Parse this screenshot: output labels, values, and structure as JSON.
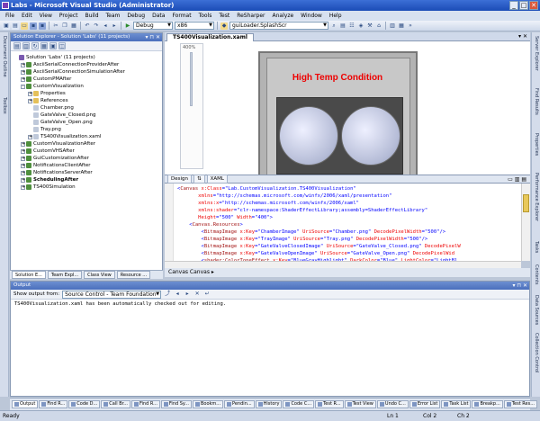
{
  "window": {
    "title": "Labs - Microsoft Visual Studio (Administrator)"
  },
  "menu": [
    "File",
    "Edit",
    "View",
    "Project",
    "Build",
    "Team",
    "Debug",
    "Data",
    "Format",
    "Tools",
    "Test",
    "ReSharper",
    "Analyze",
    "Window",
    "Help"
  ],
  "toolbar": {
    "config": "Debug",
    "platform": "x86",
    "startup": "guiLoader.SplashScr"
  },
  "left_strip": [
    "Document Outline",
    "Toolbox"
  ],
  "right_strip": [
    "Server Explorer",
    "Find Results",
    "Properties",
    "Performance Explorer",
    "Tasks",
    "Contents",
    "Data Sources",
    "Collection Control"
  ],
  "solution_explorer": {
    "title": "Solution Explorer - Solution 'Labs' (11 projects)",
    "tree": [
      {
        "label": "Solution 'Labs' (11 projects)",
        "indent": 0,
        "icon": "sol",
        "bold": false,
        "exp": ""
      },
      {
        "label": "AsciiSerialConnectionProviderAfter",
        "indent": 1,
        "icon": "proj",
        "bold": false,
        "exp": "+"
      },
      {
        "label": "AsciiSerialConnectionSimulationAfter",
        "indent": 1,
        "icon": "proj",
        "bold": false,
        "exp": "+"
      },
      {
        "label": "CustomPMAfter",
        "indent": 1,
        "icon": "proj",
        "bold": false,
        "exp": "+"
      },
      {
        "label": "CustomVisualization",
        "indent": 1,
        "icon": "proj",
        "bold": false,
        "exp": "-"
      },
      {
        "label": "Properties",
        "indent": 2,
        "icon": "folder",
        "bold": false,
        "exp": "+"
      },
      {
        "label": "References",
        "indent": 2,
        "icon": "folder",
        "bold": false,
        "exp": "+"
      },
      {
        "label": "Chamber.png",
        "indent": 2,
        "icon": "file",
        "bold": false,
        "exp": ""
      },
      {
        "label": "GateValve_Closed.png",
        "indent": 2,
        "icon": "file",
        "bold": false,
        "exp": ""
      },
      {
        "label": "GateValve_Open.png",
        "indent": 2,
        "icon": "file",
        "bold": false,
        "exp": ""
      },
      {
        "label": "Tray.png",
        "indent": 2,
        "icon": "file",
        "bold": false,
        "exp": ""
      },
      {
        "label": "TS400Visualization.xaml",
        "indent": 2,
        "icon": "file",
        "bold": false,
        "exp": "+"
      },
      {
        "label": "CustomVisualizationAfter",
        "indent": 1,
        "icon": "proj",
        "bold": false,
        "exp": "+"
      },
      {
        "label": "CustomVHSAfter",
        "indent": 1,
        "icon": "proj",
        "bold": false,
        "exp": "+"
      },
      {
        "label": "GuiCustomizationAfter",
        "indent": 1,
        "icon": "proj",
        "bold": false,
        "exp": "+"
      },
      {
        "label": "NotificationsClientAfter",
        "indent": 1,
        "icon": "proj",
        "bold": false,
        "exp": "+"
      },
      {
        "label": "NotificationsServerAfter",
        "indent": 1,
        "icon": "proj",
        "bold": false,
        "exp": "+"
      },
      {
        "label": "SchedulingAfter",
        "indent": 1,
        "icon": "proj",
        "bold": true,
        "exp": "+"
      },
      {
        "label": "TS400Simulation",
        "indent": 1,
        "icon": "proj",
        "bold": false,
        "exp": "+"
      }
    ],
    "tabs": [
      "Solution E...",
      "Team Expl...",
      "Class View",
      "Resource ..."
    ]
  },
  "document": {
    "tab": "TS400Visualization.xaml",
    "zoom": "400%",
    "canvas_title": "High Temp Condition",
    "split_tabs": [
      "Design",
      "⇅",
      "XAML"
    ],
    "breadcrumb": "Canvas  Canvas ▸",
    "code": [
      [
        [
          "t-pun",
          "<"
        ],
        [
          "t-tag",
          "Canvas"
        ],
        [
          "t-attr",
          " x:Class"
        ],
        [
          "t-pun",
          "="
        ],
        [
          "t-val",
          "\"Lab.CustomVisualization.TS400Visualization\""
        ]
      ],
      [
        [
          "t-attr",
          "       xmlns"
        ],
        [
          "t-pun",
          "="
        ],
        [
          "t-val",
          "\"http://schemas.microsoft.com/winfx/2006/xaml/presentation\""
        ]
      ],
      [
        [
          "t-attr",
          "       xmlns:x"
        ],
        [
          "t-pun",
          "="
        ],
        [
          "t-val",
          "\"http://schemas.microsoft.com/winfx/2006/xaml\""
        ]
      ],
      [
        [
          "t-attr",
          "       xmlns:shader"
        ],
        [
          "t-pun",
          "="
        ],
        [
          "t-val",
          "\"clr-namespace:ShaderEffectLibrary;assembly=ShaderEffectLibrary\""
        ]
      ],
      [
        [
          "t-attr",
          "       Height"
        ],
        [
          "t-pun",
          "="
        ],
        [
          "t-val",
          "\"500\""
        ],
        [
          "t-attr",
          " Width"
        ],
        [
          "t-pun",
          "="
        ],
        [
          "t-val",
          "\"400\""
        ],
        [
          "t-pun",
          ">"
        ]
      ],
      [
        [
          "t-pun",
          "    <"
        ],
        [
          "t-tag",
          "Canvas.Resources"
        ],
        [
          "t-pun",
          ">"
        ]
      ],
      [
        [
          "t-pun",
          "        <"
        ],
        [
          "t-tag",
          "BitmapImage"
        ],
        [
          "t-attr",
          " x:Key"
        ],
        [
          "t-pun",
          "="
        ],
        [
          "t-val",
          "\"ChamberImage\""
        ],
        [
          "t-attr",
          " UriSource"
        ],
        [
          "t-pun",
          "="
        ],
        [
          "t-val",
          "\"Chamber.png\""
        ],
        [
          "t-attr",
          " DecodePixelWidth"
        ],
        [
          "t-pun",
          "="
        ],
        [
          "t-val",
          "\"500\""
        ],
        [
          "t-pun",
          "/>"
        ]
      ],
      [
        [
          "t-pun",
          "        <"
        ],
        [
          "t-tag",
          "BitmapImage"
        ],
        [
          "t-attr",
          " x:Key"
        ],
        [
          "t-pun",
          "="
        ],
        [
          "t-val",
          "\"TrayImage\""
        ],
        [
          "t-attr",
          " UriSource"
        ],
        [
          "t-pun",
          "="
        ],
        [
          "t-val",
          "\"Tray.png\""
        ],
        [
          "t-attr",
          " DecodePixelWidth"
        ],
        [
          "t-pun",
          "="
        ],
        [
          "t-val",
          "\"500\""
        ],
        [
          "t-pun",
          "/>"
        ]
      ],
      [
        [
          "t-pun",
          "        <"
        ],
        [
          "t-tag",
          "BitmapImage"
        ],
        [
          "t-attr",
          " x:Key"
        ],
        [
          "t-pun",
          "="
        ],
        [
          "t-val",
          "\"GateValveClosedImage\""
        ],
        [
          "t-attr",
          " UriSource"
        ],
        [
          "t-pun",
          "="
        ],
        [
          "t-val",
          "\"GateValve_Closed.png\""
        ],
        [
          "t-attr",
          " DecodePixelW"
        ]
      ],
      [
        [
          "t-pun",
          "        <"
        ],
        [
          "t-tag",
          "BitmapImage"
        ],
        [
          "t-attr",
          " x:Key"
        ],
        [
          "t-pun",
          "="
        ],
        [
          "t-val",
          "\"GateValveOpenImage\""
        ],
        [
          "t-attr",
          " UriSource"
        ],
        [
          "t-pun",
          "="
        ],
        [
          "t-val",
          "\"GateValve_Open.png\""
        ],
        [
          "t-attr",
          " DecodePixelWid"
        ]
      ],
      [
        [
          "t-pun",
          "        <"
        ],
        [
          "t-tag",
          "shader:ColorToneEffect"
        ],
        [
          "t-attr",
          " x:Key"
        ],
        [
          "t-pun",
          "="
        ],
        [
          "t-val",
          "\"BlueGrayHighlight\""
        ],
        [
          "t-attr",
          " DarkColor"
        ],
        [
          "t-pun",
          "="
        ],
        [
          "t-val",
          "\"Blue\""
        ],
        [
          "t-attr",
          " LightColor"
        ],
        [
          "t-pun",
          "="
        ],
        [
          "t-val",
          "\"LightBl"
        ]
      ]
    ]
  },
  "output": {
    "title": "Output",
    "show_label": "Show output from:",
    "source": "Source Control - Team Foundation",
    "message": "TS400Visualization.xaml has been automatically checked out for editing."
  },
  "bottom_tabs": [
    "Output",
    "Find R...",
    "Code D...",
    "Call Br...",
    "Find R...",
    "Find Sy...",
    "Bookm...",
    "Pendin...",
    "History",
    "Code C...",
    "Test R...",
    "Test View",
    "Undo C...",
    "Error List",
    "Task List",
    "Breakp...",
    "Test Res..."
  ],
  "status": {
    "ready": "Ready",
    "ln": "Ln 1",
    "col": "Col 2",
    "ch": "Ch 2"
  }
}
